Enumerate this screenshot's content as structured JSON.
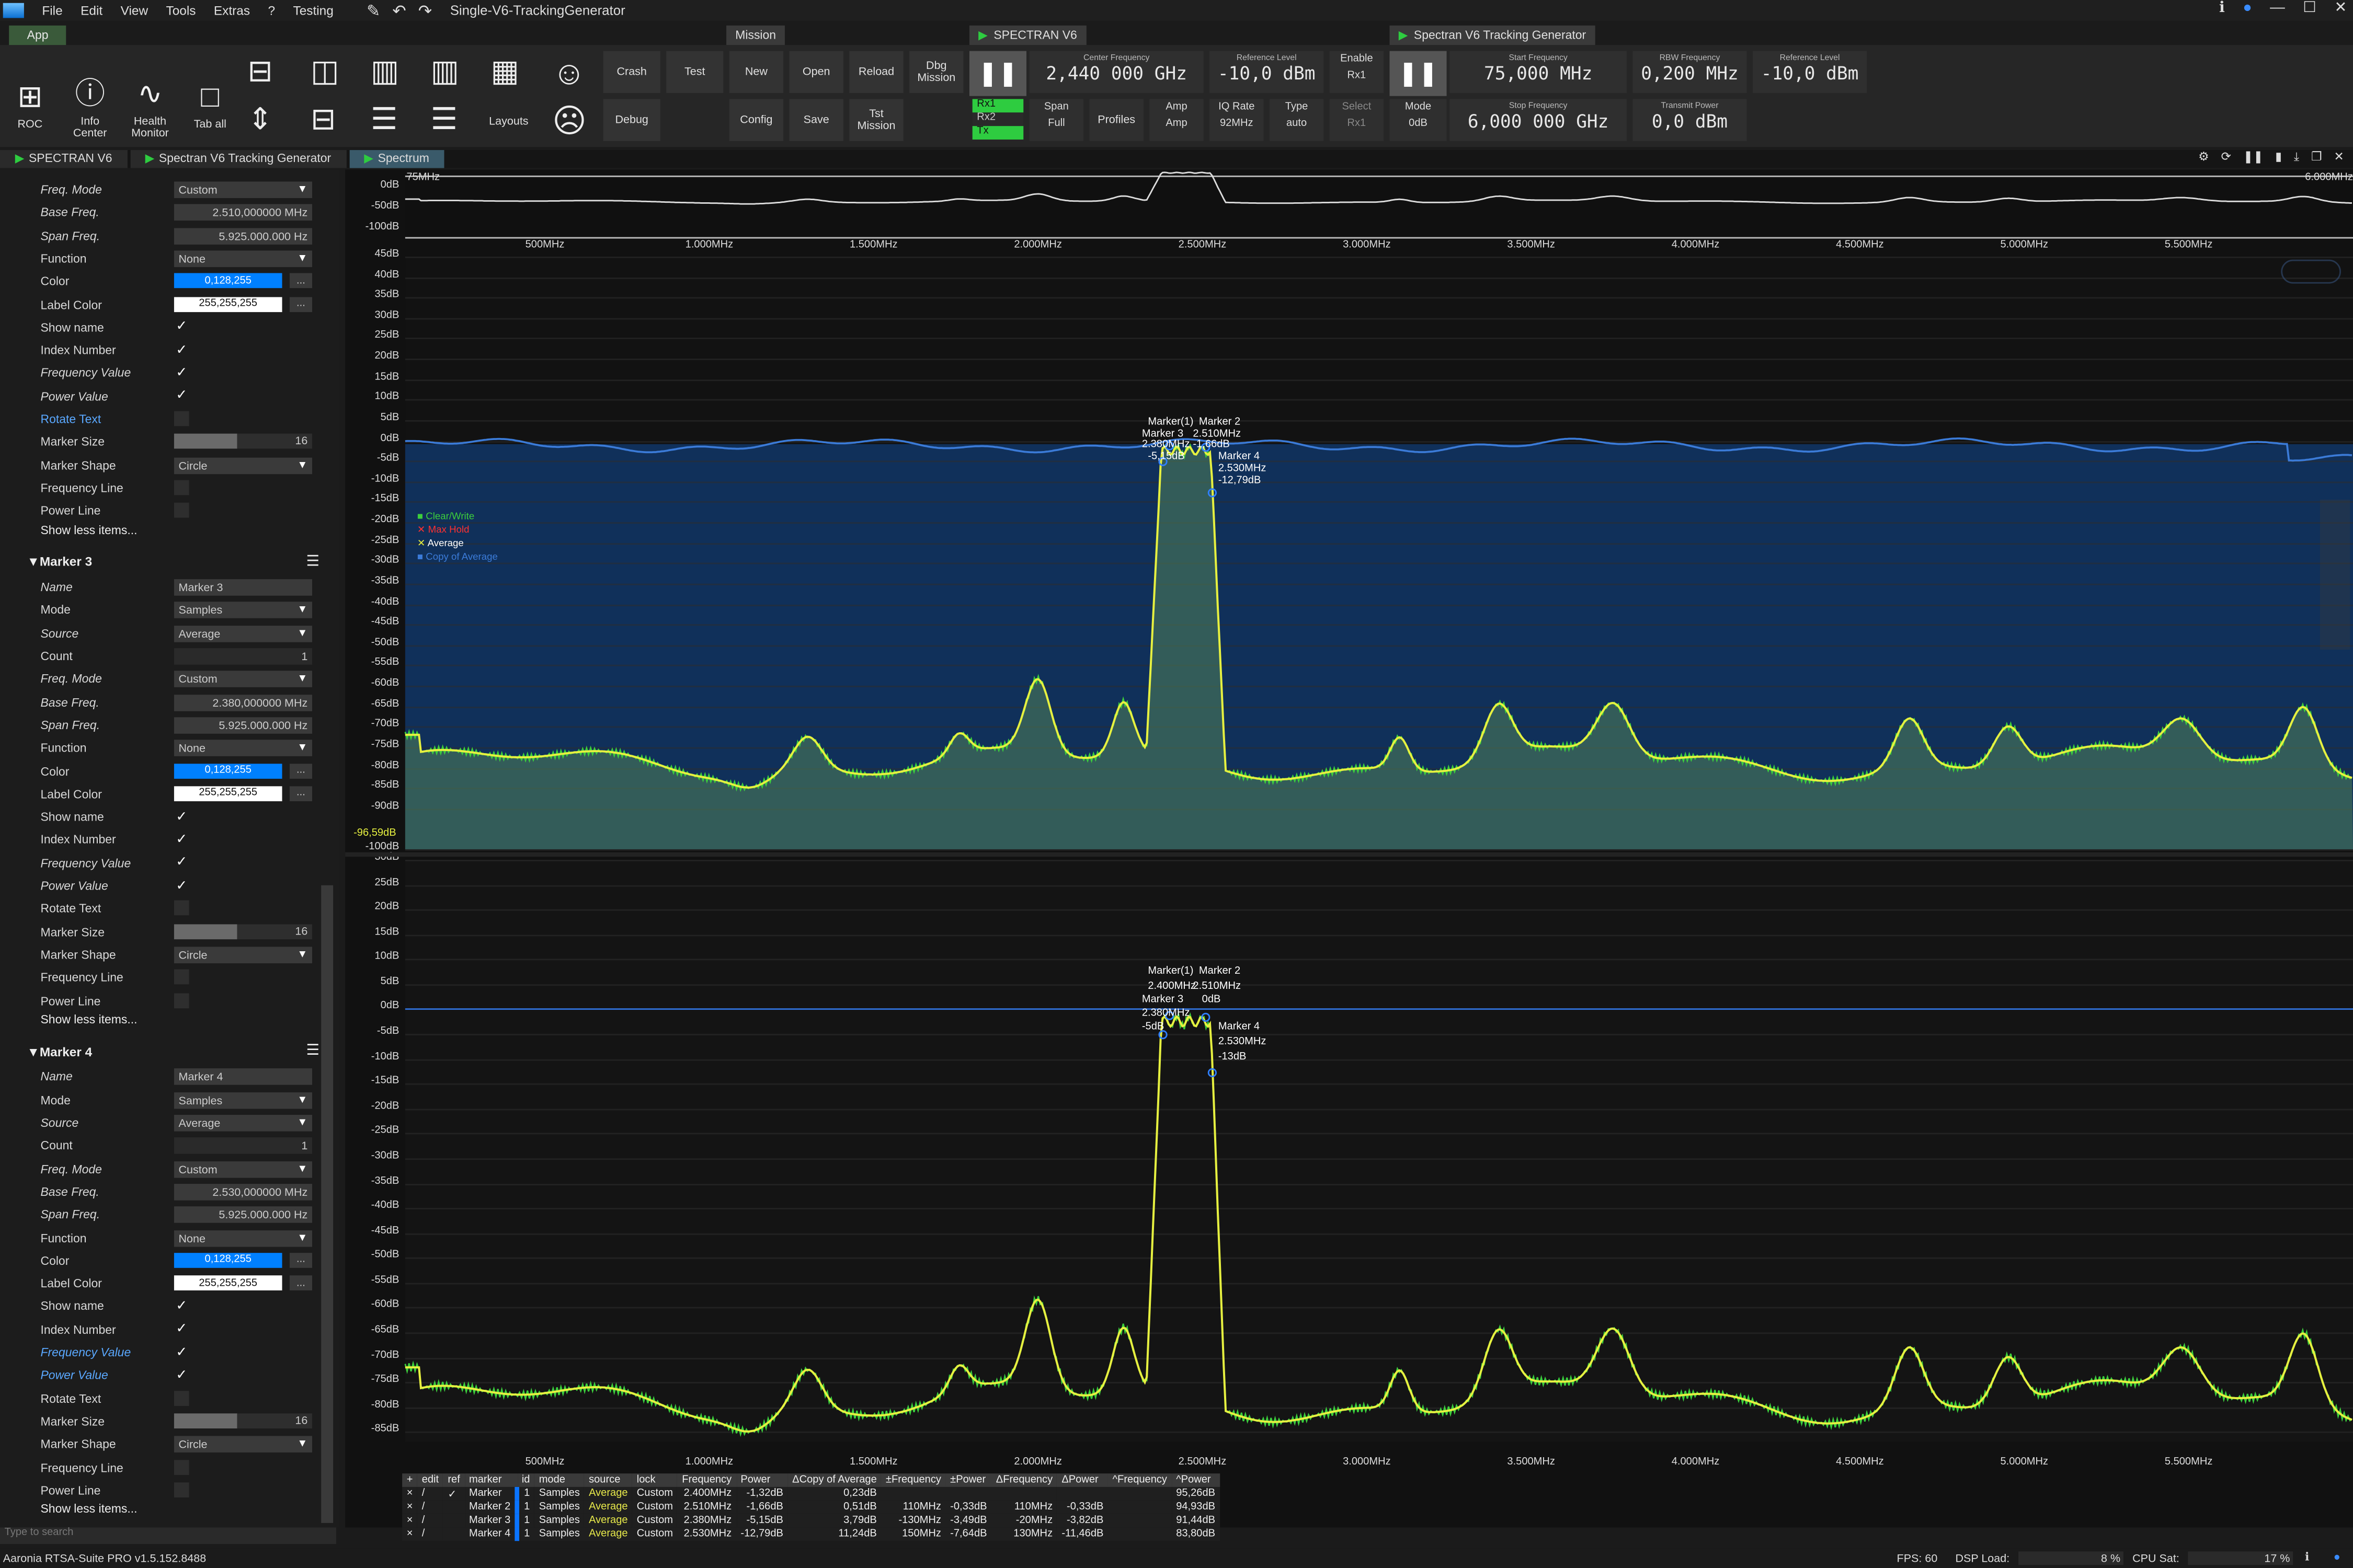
{
  "menubar": {
    "items": [
      "File",
      "Edit",
      "View",
      "Tools",
      "Extras",
      "?",
      "Testing"
    ],
    "title": "Single-V6-TrackingGenerator"
  },
  "ribbon": {
    "app_tab": "App",
    "mission_tab": "Mission",
    "buttons": {
      "roc": "ROC",
      "info": "Info Center",
      "health": "Health Monitor",
      "taball": "Tab all",
      "layouts": "Layouts",
      "crash": "Crash",
      "test": "Test",
      "debug": "Debug",
      "new": "New",
      "open": "Open",
      "reload": "Reload",
      "dbg_mission": "Dbg Mission",
      "config": "Config",
      "save": "Save",
      "tst_mission": "Tst Mission"
    },
    "spectran": {
      "title": "SPECTRAN V6",
      "center_label": "Center Frequency",
      "center_value": "2,440 000 GHz",
      "ref_label": "Reference Level",
      "ref_value": "-10,0 dBm",
      "enable_label": "Enable",
      "enable_value": "Rx1",
      "rx": [
        "Rx1",
        "Rx2",
        "Tx"
      ],
      "span_label": "Span",
      "span_value": "Full",
      "profiles": "Profiles",
      "amp_label": "Amp",
      "amp_value": "Amp",
      "iqrate_label": "IQ Rate",
      "iqrate_value": "92MHz",
      "type_label": "Type",
      "type_value": "auto",
      "select_label": "Select",
      "select_value": "Rx1"
    },
    "tracking": {
      "title": "Spectran V6 Tracking Generator",
      "start_label": "Start Frequency",
      "start_value": "75,000 MHz",
      "rbw_label": "RBW Frequency",
      "rbw_value": "0,200 MHz",
      "ref_label": "Reference Level",
      "ref_value": "-10,0 dBm",
      "mode_label": "Mode",
      "mode_value": "0dB",
      "stop_label": "Stop Frequency",
      "stop_value": "6,000 000 GHz",
      "tx_label": "Transmit Power",
      "tx_value": "0,0 dBm"
    }
  },
  "doctabs": [
    "SPECTRAN V6",
    "Spectran V6 Tracking Generator",
    "Spectrum"
  ],
  "sidebar": {
    "marker2_tail": {
      "freq_mode": "Custom",
      "base_freq": "2.510,000000 MHz",
      "span_freq": "5.925.000.000 Hz",
      "function": "None",
      "color": "0,128,255",
      "label_color": "255,255,255",
      "marker_size": "16",
      "marker_shape": "Circle"
    },
    "labels": {
      "name": "Name",
      "mode": "Mode",
      "source": "Source",
      "count": "Count",
      "freq_mode": "Freq. Mode",
      "base_freq": "Base Freq.",
      "span_freq": "Span Freq.",
      "function": "Function",
      "color": "Color",
      "label_color": "Label Color",
      "show_name": "Show name",
      "index_number": "Index Number",
      "frequency_value": "Frequency Value",
      "power_value": "Power Value",
      "rotate_text": "Rotate Text",
      "marker_size": "Marker Size",
      "marker_shape": "Marker Shape",
      "frequency_line": "Frequency Line",
      "power_line": "Power Line",
      "show_less": "Show less items...",
      "dots": "..."
    },
    "marker3": {
      "title": "Marker 3",
      "name": "Marker 3",
      "mode": "Samples",
      "source": "Average",
      "count": "1",
      "freq_mode": "Custom",
      "base_freq": "2.380,000000 MHz",
      "span_freq": "5.925.000.000 Hz",
      "function": "None",
      "color": "0,128,255",
      "label_color": "255,255,255",
      "marker_size": "16",
      "marker_shape": "Circle"
    },
    "marker4": {
      "title": "Marker 4",
      "name": "Marker 4",
      "mode": "Samples",
      "source": "Average",
      "count": "1",
      "freq_mode": "Custom",
      "base_freq": "2.530,000000 MHz",
      "span_freq": "5.925.000.000 Hz",
      "function": "None",
      "color": "0,128,255",
      "label_color": "255,255,255",
      "marker_size": "16",
      "marker_shape": "Circle"
    },
    "search_placeholder": "Type to search"
  },
  "chart_overview": {
    "start_label": "75MHz",
    "stop_label": "6.000MHz",
    "yticks": [
      "0dB",
      "-50dB",
      "-100dB"
    ]
  },
  "x_ticks": [
    "500MHz",
    "1.000MHz",
    "1.500MHz",
    "2.000MHz",
    "2.500MHz",
    "3.000MHz",
    "3.500MHz",
    "4.000MHz",
    "4.500MHz",
    "5.000MHz",
    "5.500MHz"
  ],
  "chart_main": {
    "yticks": [
      "45dB",
      "40dB",
      "35dB",
      "30dB",
      "25dB",
      "20dB",
      "15dB",
      "10dB",
      "5dB",
      "0dB",
      "-5dB",
      "-10dB",
      "-15dB",
      "-20dB",
      "-25dB",
      "-30dB",
      "-35dB",
      "-40dB",
      "-45dB",
      "-50dB",
      "-55dB",
      "-60dB",
      "-65dB",
      "-70dB",
      "-75dB",
      "-80dB",
      "-85dB",
      "-90dB",
      "-100dB"
    ],
    "cursor_label": "-96,59dB",
    "legend": [
      "Clear/Write",
      "Max Hold",
      "Average",
      "Copy of Average"
    ],
    "markers": {
      "m1": "Marker(1)",
      "m2": "Marker 2",
      "m1b": "Marker 3",
      "m2b": "2.510MHz",
      "m1c": "2.380MHz",
      "m2c": "-1,66dB",
      "m1d": "-5,15dB",
      "m4a": "Marker 4",
      "m4b": "2.530MHz",
      "m4c": "-12,79dB"
    }
  },
  "chart_lower": {
    "yticks": [
      "30dB",
      "25dB",
      "20dB",
      "15dB",
      "10dB",
      "5dB",
      "0dB",
      "-5dB",
      "-10dB",
      "-15dB",
      "-20dB",
      "-25dB",
      "-30dB",
      "-35dB",
      "-40dB",
      "-45dB",
      "-50dB",
      "-55dB",
      "-60dB",
      "-65dB",
      "-70dB",
      "-75dB",
      "-80dB",
      "-85dB"
    ],
    "markers": {
      "m1": "Marker(1)",
      "m2": "Marker 2",
      "m1b": "2.400MHz",
      "m2b": "2.510MHz",
      "m1c": "Marker 3",
      "m2c": "0dB",
      "m1d": "2.380MHz",
      "m1e": "-5dB",
      "m4a": "Marker 4",
      "m4b": "2.530MHz",
      "m4c": "-13dB"
    }
  },
  "marker_table": {
    "headers": [
      "+",
      "edit",
      "ref",
      "marker",
      "id",
      "mode",
      "source",
      "lock",
      "Frequency",
      "Power",
      "ΔCopy of Average",
      "±Frequency",
      "±Power",
      "ΔFrequency",
      "ΔPower",
      "^Frequency",
      "^Power"
    ],
    "rows": [
      [
        "×",
        "/",
        "✓",
        "Marker",
        "1",
        "Samples",
        "Average",
        "Custom",
        "2.400MHz",
        "-1,32dB",
        "0,23dB",
        "",
        "",
        "",
        "",
        "",
        "95,26dB"
      ],
      [
        "×",
        "/",
        "",
        "Marker 2",
        "1",
        "Samples",
        "Average",
        "Custom",
        "2.510MHz",
        "-1,66dB",
        "0,51dB",
        "110MHz",
        "-0,33dB",
        "110MHz",
        "-0,33dB",
        "",
        "94,93dB"
      ],
      [
        "×",
        "/",
        "",
        "Marker 3",
        "1",
        "Samples",
        "Average",
        "Custom",
        "2.380MHz",
        "-5,15dB",
        "3,79dB",
        "-130MHz",
        "-3,49dB",
        "-20MHz",
        "-3,82dB",
        "",
        "91,44dB"
      ],
      [
        "×",
        "/",
        "",
        "Marker 4",
        "1",
        "Samples",
        "Average",
        "Custom",
        "2.530MHz",
        "-12,79dB",
        "11,24dB",
        "150MHz",
        "-7,64dB",
        "130MHz",
        "-11,46dB",
        "",
        "83,80dB"
      ]
    ]
  },
  "status": {
    "version": "Aaronia RTSA-Suite PRO v1.5.152.8488",
    "fps": "FPS: 60",
    "dsp": "DSP Load:",
    "dsp_val": "8 %",
    "cpu": "CPU Sat:",
    "cpu_val": "17 %"
  },
  "colors": {
    "accent": "#0080ff",
    "average_trace": "#e6f040",
    "clearwrite_trace": "#3ccf3c",
    "copy_trace": "#2f6fd6",
    "maxhold": "#ff3030",
    "active_green": "#2ecc40"
  }
}
